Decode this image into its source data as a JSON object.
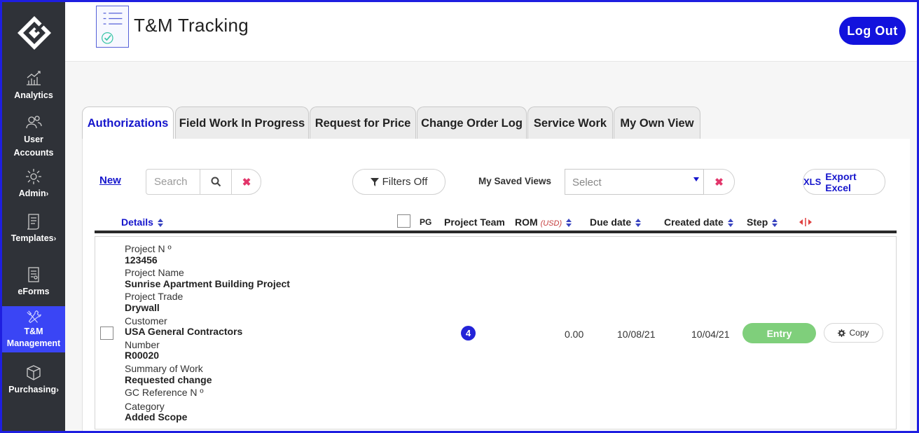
{
  "app": {
    "title": "T&M Tracking",
    "logout_label": "Log Out"
  },
  "sidebar": {
    "items": [
      {
        "label": "Analytics",
        "icon": "analytics-icon"
      },
      {
        "label": "User Accounts",
        "icon": "users-icon"
      },
      {
        "label": "Admin",
        "icon": "gear-icon",
        "chevron": "›"
      },
      {
        "label": "Templates",
        "icon": "document-icon",
        "chevron": "›"
      },
      {
        "label": "eForms",
        "icon": "form-icon"
      },
      {
        "label": "T&M Management",
        "icon": "tools-icon",
        "chevron": "›",
        "active": true
      },
      {
        "label": "Purchasing",
        "icon": "box-icon",
        "chevron": "›"
      }
    ]
  },
  "tabs": [
    {
      "label": "Authorizations",
      "active": true
    },
    {
      "label": "Field Work In Progress"
    },
    {
      "label": "Request for Price"
    },
    {
      "label": "Change Order Log"
    },
    {
      "label": "Service Work"
    },
    {
      "label": "My Own View"
    }
  ],
  "toolbar": {
    "new_label": "New",
    "search_placeholder": "Search",
    "filters_label": "Filters Off",
    "saved_views_label": "My Saved Views",
    "saved_views_value": "Select",
    "export_xls": "XLS",
    "export_label": "Export Excel"
  },
  "table": {
    "headers": {
      "details": "Details",
      "pg": "PG",
      "project_team": "Project Team",
      "rom": "ROM",
      "rom_unit": "(USD)",
      "due_date": "Due date",
      "created_date": "Created date",
      "step": "Step"
    },
    "rows": [
      {
        "details": [
          {
            "label": "Project N º",
            "value": "123456"
          },
          {
            "label": "Project Name",
            "value": "Sunrise Apartment Building Project"
          },
          {
            "label": "Project Trade",
            "value": "Drywall"
          },
          {
            "label": "Customer",
            "value": "USA General Contractors"
          },
          {
            "label": "Number",
            "value": "R00020"
          },
          {
            "label": "Summary of Work",
            "value": "Requested change"
          },
          {
            "label": "GC Reference N º",
            "value": ""
          },
          {
            "label": "Category",
            "value": "Added Scope"
          }
        ],
        "project_team": "4",
        "rom": "0.00",
        "due_date": "10/08/21",
        "created_date": "10/04/21",
        "step": "Entry",
        "copy_label": "Copy"
      }
    ]
  },
  "colors": {
    "accent": "#1515cc",
    "sidebar_bg": "#2f3238",
    "sidebar_active": "#3a45f5",
    "step_entry": "#7fcf7b",
    "clear_red": "#e2356a"
  }
}
